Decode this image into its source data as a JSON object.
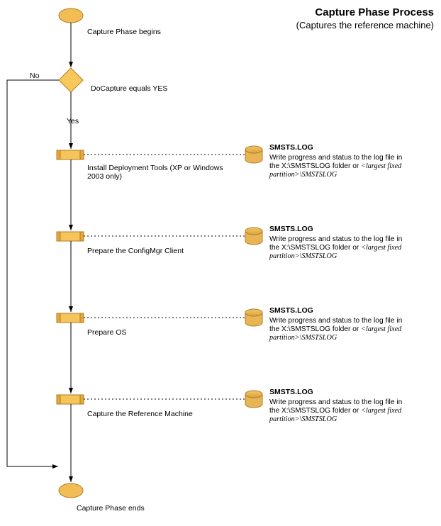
{
  "title": "Capture Phase Process",
  "subtitle": "(Captures the reference machine)",
  "start_label": "Capture Phase begins",
  "decision_label": "DoCapture equals YES",
  "decision_yes": "Yes",
  "decision_no": "No",
  "end_label": "Capture Phase ends",
  "steps": [
    {
      "label": "Install Deployment Tools (XP or Windows 2003 only)"
    },
    {
      "label": "Prepare the ConfigMgr Client"
    },
    {
      "label": "Prepare OS"
    },
    {
      "label": "Capture the Reference Machine"
    }
  ],
  "log": {
    "name": "SMSTS.LOG",
    "desc_pre": "Write progress and status to the log file in the X:\\SMSTSLOG folder or ",
    "desc_italic": "<largest fixed partition>",
    "desc_post": "\\SMSTSLOG"
  },
  "chart_data": {
    "type": "flowchart",
    "nodes": [
      {
        "id": "start",
        "kind": "terminator",
        "label": "Capture Phase begins"
      },
      {
        "id": "d1",
        "kind": "decision",
        "label": "DoCapture equals YES"
      },
      {
        "id": "p1",
        "kind": "process",
        "label": "Install Deployment Tools (XP or Windows 2003 only)",
        "log": "SMSTS.LOG"
      },
      {
        "id": "p2",
        "kind": "process",
        "label": "Prepare the ConfigMgr Client",
        "log": "SMSTS.LOG"
      },
      {
        "id": "p3",
        "kind": "process",
        "label": "Prepare OS",
        "log": "SMSTS.LOG"
      },
      {
        "id": "p4",
        "kind": "process",
        "label": "Capture the Reference Machine",
        "log": "SMSTS.LOG"
      },
      {
        "id": "end",
        "kind": "terminator",
        "label": "Capture Phase ends"
      }
    ],
    "edges": [
      {
        "from": "start",
        "to": "d1"
      },
      {
        "from": "d1",
        "to": "p1",
        "label": "Yes"
      },
      {
        "from": "d1",
        "to": "end",
        "label": "No"
      },
      {
        "from": "p1",
        "to": "p2"
      },
      {
        "from": "p2",
        "to": "p3"
      },
      {
        "from": "p3",
        "to": "p4"
      },
      {
        "from": "p4",
        "to": "end"
      }
    ]
  }
}
